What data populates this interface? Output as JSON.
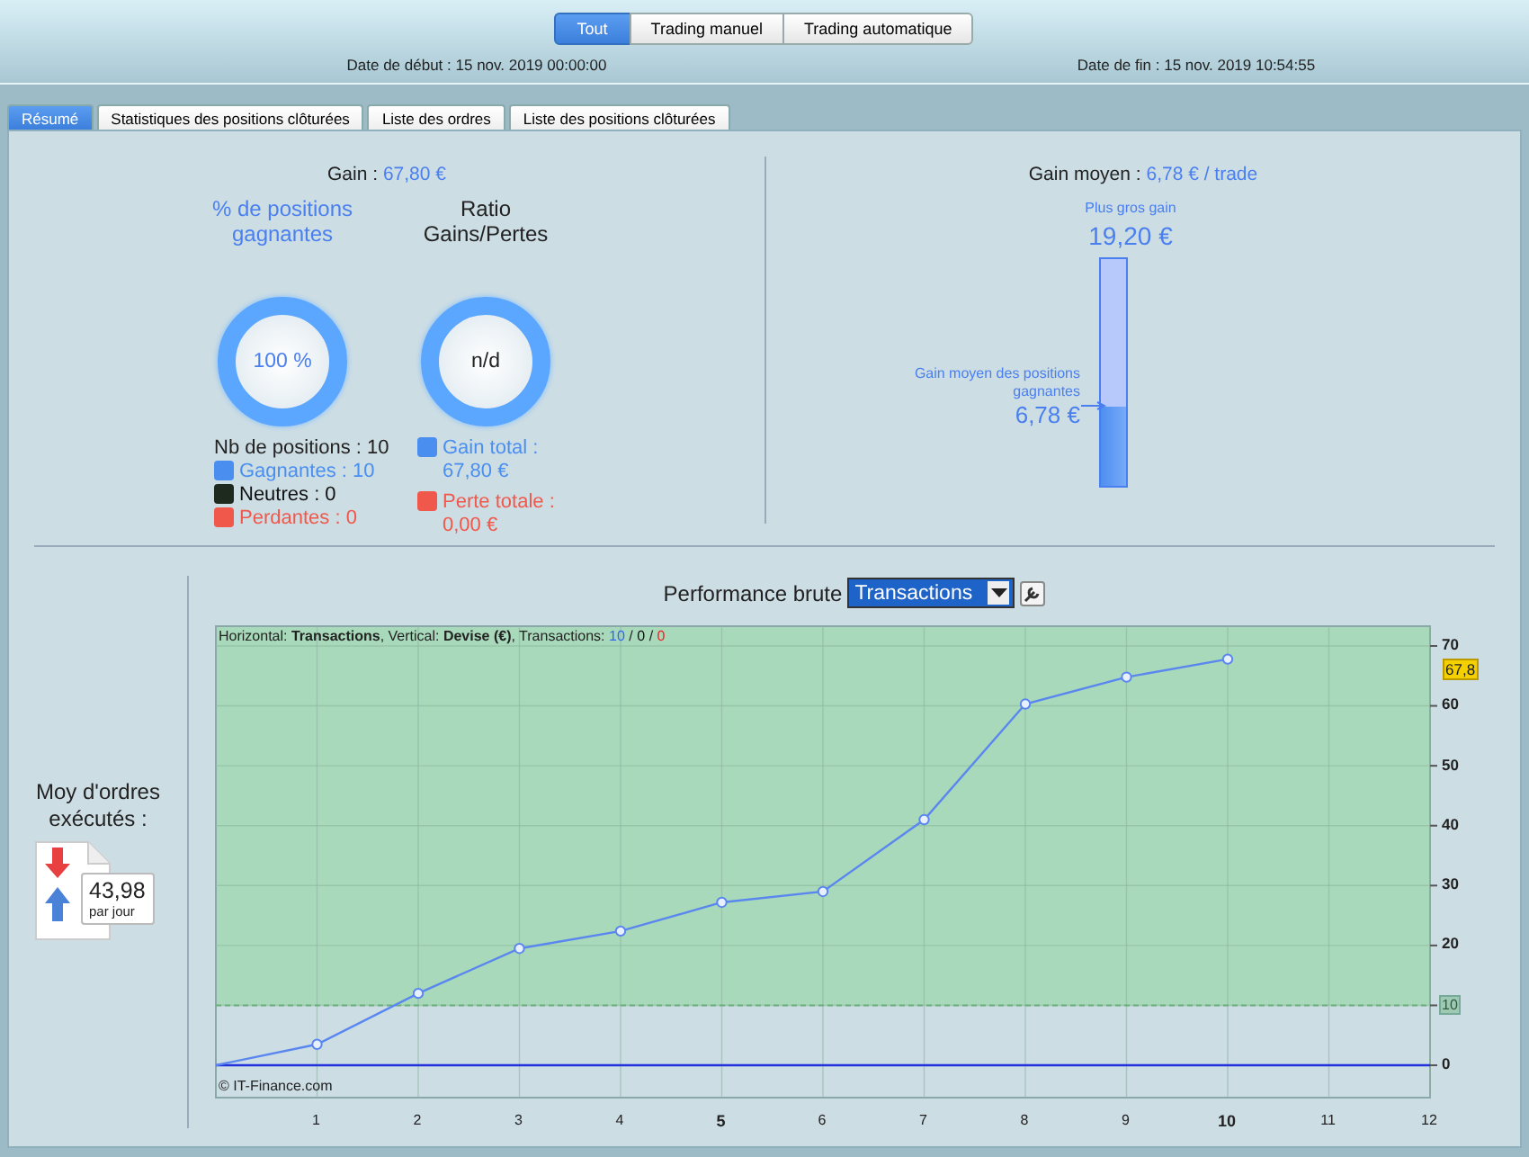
{
  "mode_buttons": [
    {
      "label": "Tout",
      "selected": true
    },
    {
      "label": "Trading manuel",
      "selected": false
    },
    {
      "label": "Trading automatique",
      "selected": false
    }
  ],
  "dates": {
    "start_label": "Date de début :",
    "start": "15 nov. 2019 00:00:00",
    "end_label": "Date de fin :",
    "end": "15 nov. 2019 10:54:55"
  },
  "tabs": [
    {
      "label": "Résumé",
      "selected": true
    },
    {
      "label": "Statistiques des positions clôturées",
      "selected": false
    },
    {
      "label": "Liste des ordres",
      "selected": false
    },
    {
      "label": "Liste des positions clôturées",
      "selected": false
    }
  ],
  "gain": {
    "label": "Gain :",
    "value": "67,80 €"
  },
  "winning_gauge": {
    "title": "% de positions gagnantes",
    "value": "100 %"
  },
  "ratio_gauge": {
    "title": "Ratio Gains/Pertes",
    "value": "n/d"
  },
  "positions": {
    "total": "Nb de positions : 10",
    "items": [
      {
        "label": "Gagnantes : 10",
        "color": "#4a8ff0"
      },
      {
        "label": "Neutres : 0",
        "color": "#1f2a1f"
      },
      {
        "label": "Perdantes : 0",
        "color": "#f0584c"
      }
    ]
  },
  "totals": [
    {
      "label": "Gain total :",
      "value": "67,80 €",
      "color": "#4a8ff0"
    },
    {
      "label": "Perte totale :",
      "value": "0,00 €",
      "color": "#f0584c"
    }
  ],
  "average_gain": {
    "label": "Gain moyen :",
    "value": "6,78 € / trade",
    "max_label": "Plus gros gain",
    "max_value": "19,20 €",
    "avg_label": "Gain moyen des positions gagnantes",
    "avg_value": "6,78 €",
    "level": 0.353
  },
  "orders": {
    "title": "Moy d'ordres exécutés :",
    "value": "43,98",
    "unit": "par jour"
  },
  "performance": {
    "label": "Performance brute",
    "selector": "Transactions",
    "legend": {
      "text": "Horizontal: **Transactions**, Vertical: **Devise (€)**, Transactions:",
      "counts": [
        {
          "value": "10",
          "color": "#3366ee"
        },
        {
          "value": "0",
          "color": "#111111"
        },
        {
          "value": "0",
          "color": "#ee2222"
        }
      ],
      "separator": "/"
    },
    "credit": "© IT-Finance.com",
    "chart_data": {
      "type": "line",
      "x": [
        0,
        1,
        2,
        3,
        4,
        5,
        6,
        7,
        8,
        9,
        10
      ],
      "series": [
        {
          "color": "#5a86f0",
          "marker": "o",
          "values": [
            0,
            3.5,
            12,
            19.5,
            22.4,
            27.2,
            29,
            41,
            60.3,
            64.8,
            67.8
          ]
        }
      ],
      "grid": true,
      "bands": [
        {
          "axis": "y",
          "from": 10,
          "to": 73.3,
          "color": "#a9d9bb"
        }
      ],
      "ref_lines": [
        {
          "axis": "y",
          "value": 10,
          "color": "#6ab07a"
        },
        {
          "axis": "y",
          "value": 0,
          "color": "#2233dd"
        }
      ],
      "xlim": [
        0,
        12
      ],
      "ylim": [
        -5.4,
        73.3
      ],
      "xticks": [
        1,
        2,
        3,
        4,
        5,
        6,
        7,
        8,
        9,
        10,
        11,
        12
      ],
      "yticks": [
        0,
        10,
        20,
        30,
        40,
        50,
        60,
        70
      ],
      "annotations": [
        {
          "x": 12,
          "y": 67.8,
          "text": "67,8"
        }
      ]
    },
    "threshold_tag": "10"
  }
}
